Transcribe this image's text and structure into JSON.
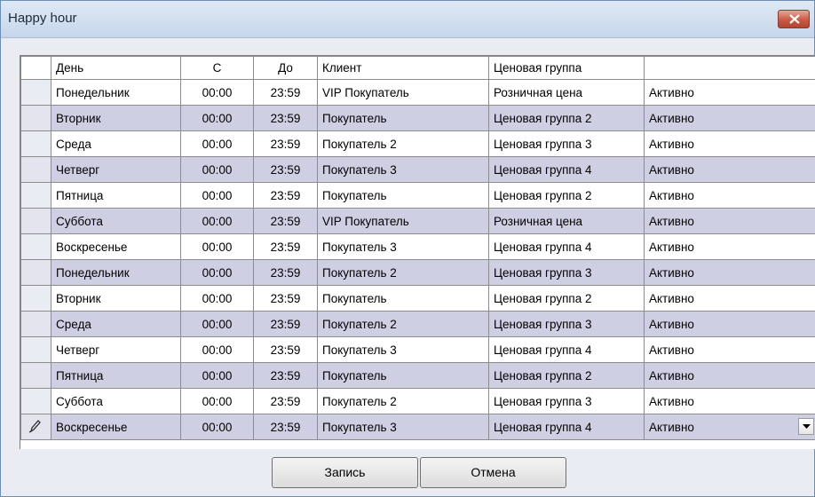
{
  "window": {
    "title": "Happy hour"
  },
  "table": {
    "columns": [
      "",
      "День",
      "С",
      "До",
      "Клиент",
      "Ценовая группа",
      ""
    ],
    "rows": [
      {
        "day": "Понедельник",
        "from": "00:00",
        "to": "23:59",
        "client": "VIP Покупатель",
        "group": "Розничная цена",
        "status": "Активно"
      },
      {
        "day": "Вторник",
        "from": "00:00",
        "to": "23:59",
        "client": "Покупатель",
        "group": "Ценовая группа 2",
        "status": "Активно"
      },
      {
        "day": "Среда",
        "from": "00:00",
        "to": "23:59",
        "client": "Покупатель 2",
        "group": "Ценовая группа 3",
        "status": "Активно"
      },
      {
        "day": "Четверг",
        "from": "00:00",
        "to": "23:59",
        "client": "Покупатель 3",
        "group": "Ценовая группа 4",
        "status": "Активно"
      },
      {
        "day": "Пятница",
        "from": "00:00",
        "to": "23:59",
        "client": "Покупатель",
        "group": "Ценовая группа 2",
        "status": "Активно"
      },
      {
        "day": "Суббота",
        "from": "00:00",
        "to": "23:59",
        "client": "VIP Покупатель",
        "group": "Розничная цена",
        "status": "Активно"
      },
      {
        "day": "Воскресенье",
        "from": "00:00",
        "to": "23:59",
        "client": "Покупатель 3",
        "group": "Ценовая группа 4",
        "status": "Активно"
      },
      {
        "day": "Понедельник",
        "from": "00:00",
        "to": "23:59",
        "client": "Покупатель 2",
        "group": "Ценовая группа 3",
        "status": "Активно"
      },
      {
        "day": "Вторник",
        "from": "00:00",
        "to": "23:59",
        "client": "Покупатель",
        "group": "Ценовая группа 2",
        "status": "Активно"
      },
      {
        "day": "Среда",
        "from": "00:00",
        "to": "23:59",
        "client": "Покупатель 2",
        "group": "Ценовая группа 3",
        "status": "Активно"
      },
      {
        "day": "Четверг",
        "from": "00:00",
        "to": "23:59",
        "client": "Покупатель 3",
        "group": "Ценовая группа 4",
        "status": "Активно"
      },
      {
        "day": "Пятница",
        "from": "00:00",
        "to": "23:59",
        "client": "Покупатель",
        "group": "Ценовая группа 2",
        "status": "Активно"
      },
      {
        "day": "Суббота",
        "from": "00:00",
        "to": "23:59",
        "client": "Покупатель 2",
        "group": "Ценовая группа 3",
        "status": "Активно"
      },
      {
        "day": "Воскресенье",
        "from": "00:00",
        "to": "23:59",
        "client": "Покупатель 3",
        "group": "Ценовая группа 4",
        "status": "Активно"
      }
    ]
  },
  "buttons": {
    "save": "Запись",
    "cancel": "Отмена"
  },
  "colors": {
    "alt_row": "#cfcfe4",
    "title_bar": "#c6d6ea",
    "close": "#c85a44"
  },
  "icons": {
    "close": "close-icon",
    "edit_row": "pencil-icon",
    "dropdown": "chevron-down-icon"
  }
}
